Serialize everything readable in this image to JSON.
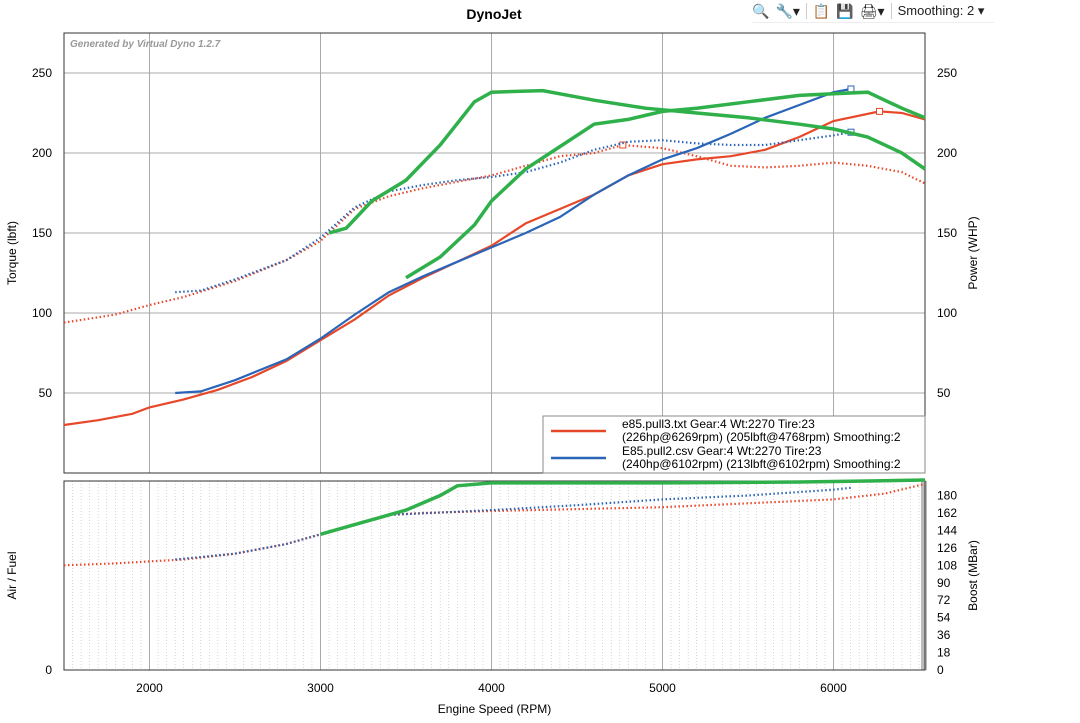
{
  "toolbar": {
    "zoom_icon": "magnifier-minus-icon",
    "tools_icon": "tools-icon",
    "paste_icon": "clipboard-icon",
    "save_icon": "floppy-save-icon",
    "print_icon": "printer-icon",
    "smoothing_label": "Smoothing: 2"
  },
  "colors": {
    "red": "#e8482a",
    "blue": "#2a65b8",
    "green": "#2fb04b"
  },
  "chart_data": [
    {
      "type": "line",
      "title": "DynoJet",
      "watermark": "Generated by Virtual Dyno 1.2.7",
      "xlabel": "Engine Speed (RPM)",
      "ylabel": "Torque (lbft)",
      "y2label": "Power (WHP)",
      "xlim": [
        1500,
        6535
      ],
      "ylim": [
        0,
        275
      ],
      "y2lim": [
        0,
        275
      ],
      "xticks": [
        2000,
        3000,
        4000,
        5000,
        6000
      ],
      "yticks": [
        50,
        100,
        150,
        200,
        250
      ],
      "y2ticks": [
        50,
        100,
        150,
        200,
        250
      ],
      "grid": true,
      "legend_position": "bottom-right",
      "legend": [
        {
          "line1": "e85.pull3.txt Gear:4 Wt:2270 Tire:23",
          "line2": "(226hp@6269rpm) (205lbft@4768rpm) Smoothing:2",
          "color": "red"
        },
        {
          "line1": "E85.pull2.csv Gear:4 Wt:2270 Tire:23",
          "line2": "(240hp@6102rpm) (213lbft@6102rpm) Smoothing:2",
          "color": "blue"
        }
      ],
      "series": [
        {
          "name": "e85.pull3 torque",
          "color": "red",
          "style": "dotted",
          "peak": [
            4768,
            205
          ],
          "x": [
            1500,
            1800,
            2000,
            2200,
            2500,
            2800,
            3000,
            3200,
            3400,
            3600,
            3800,
            4000,
            4200,
            4400,
            4600,
            4768,
            5000,
            5200,
            5400,
            5600,
            5800,
            6000,
            6200,
            6400,
            6535
          ],
          "y": [
            94,
            99,
            105,
            110,
            120,
            133,
            145,
            165,
            173,
            178,
            182,
            186,
            192,
            198,
            200,
            205,
            203,
            198,
            192,
            191,
            192,
            194,
            192,
            188,
            181
          ]
        },
        {
          "name": "e85.pull3 power",
          "color": "red",
          "style": "solid",
          "peak": [
            6269,
            226
          ],
          "x": [
            1500,
            1700,
            1900,
            2000,
            2200,
            2400,
            2600,
            2800,
            3000,
            3200,
            3400,
            3600,
            3800,
            4000,
            4200,
            4400,
            4600,
            4800,
            5000,
            5200,
            5400,
            5600,
            5800,
            6000,
            6269,
            6400,
            6535
          ],
          "y": [
            30,
            33,
            37,
            41,
            46,
            52,
            60,
            70,
            83,
            96,
            111,
            122,
            132,
            142,
            156,
            165,
            174,
            186,
            193,
            196,
            198,
            202,
            210,
            220,
            226,
            225,
            221
          ]
        },
        {
          "name": "E85.pull2 torque",
          "color": "blue",
          "style": "dotted",
          "peak": [
            6102,
            213
          ],
          "x": [
            2150,
            2300,
            2500,
            2800,
            3000,
            3200,
            3400,
            3600,
            3800,
            4000,
            4200,
            4400,
            4600,
            4800,
            5000,
            5200,
            5400,
            5600,
            5800,
            6000,
            6102
          ],
          "y": [
            113,
            114,
            121,
            133,
            147,
            166,
            176,
            180,
            183,
            185,
            188,
            194,
            202,
            207,
            208,
            206,
            205,
            205,
            208,
            211,
            213
          ]
        },
        {
          "name": "E85.pull2 power",
          "color": "blue",
          "style": "solid",
          "peak": [
            6102,
            240
          ],
          "x": [
            2150,
            2300,
            2500,
            2800,
            3000,
            3200,
            3400,
            3600,
            3800,
            4000,
            4200,
            4400,
            4600,
            4800,
            5000,
            5200,
            5400,
            5600,
            5800,
            6000,
            6102
          ],
          "y": [
            50,
            51,
            58,
            71,
            84,
            99,
            113,
            123,
            132,
            141,
            150,
            160,
            174,
            186,
            196,
            203,
            212,
            222,
            230,
            238,
            240
          ]
        },
        {
          "name": "third run torque",
          "color": "green",
          "style": "thick",
          "x": [
            3050,
            3150,
            3300,
            3500,
            3700,
            3900,
            4000,
            4300,
            4600,
            4900,
            5200,
            5500,
            5800,
            6000,
            6200,
            6400,
            6535
          ],
          "y": [
            150,
            153,
            170,
            183,
            205,
            232,
            238,
            239,
            233,
            228,
            225,
            222,
            218,
            215,
            210,
            200,
            190
          ]
        },
        {
          "name": "third run power",
          "color": "green",
          "style": "thick",
          "x": [
            3500,
            3700,
            3900,
            4000,
            4200,
            4400,
            4600,
            4800,
            5000,
            5200,
            5500,
            5800,
            6000,
            6200,
            6400,
            6535
          ],
          "y": [
            122,
            135,
            155,
            170,
            190,
            204,
            218,
            221,
            226,
            228,
            232,
            236,
            237,
            238,
            228,
            222
          ]
        }
      ]
    },
    {
      "type": "line",
      "xlabel": "Engine Speed (RPM)",
      "ylabel": "Air / Fuel",
      "y2label": "Boost (MBar)",
      "xlim": [
        1500,
        6535
      ],
      "ylim": [
        0,
        195
      ],
      "yticks": [
        0
      ],
      "y2ticks": [
        0,
        18,
        36,
        54,
        72,
        90,
        108,
        126,
        144,
        162,
        180
      ],
      "xticks": [
        2000,
        3000,
        4000,
        5000,
        6000
      ],
      "series": [
        {
          "name": "e85.pull3",
          "color": "red",
          "style": "dotted",
          "x": [
            1500,
            1800,
            2000,
            2200,
            2500,
            2800,
            3000,
            3200,
            3400,
            3600,
            4000,
            4500,
            5000,
            5500,
            6000,
            6300,
            6535
          ],
          "y": [
            108,
            110,
            112,
            114,
            120,
            130,
            140,
            150,
            160,
            162,
            164,
            166,
            168,
            172,
            176,
            182,
            192
          ]
        },
        {
          "name": "E85.pull2",
          "color": "blue",
          "style": "dotted",
          "x": [
            2150,
            2500,
            2800,
            3000,
            3200,
            3400,
            4000,
            4500,
            5000,
            5500,
            6000,
            6102
          ],
          "y": [
            114,
            120,
            130,
            140,
            150,
            160,
            165,
            170,
            176,
            180,
            186,
            188
          ]
        },
        {
          "name": "third run",
          "color": "green",
          "style": "thick",
          "x": [
            3000,
            3200,
            3500,
            3700,
            3800,
            4000,
            5000,
            5800,
            6200,
            6535
          ],
          "y": [
            140,
            150,
            165,
            180,
            190,
            193,
            193,
            194,
            195,
            196
          ]
        }
      ]
    }
  ]
}
